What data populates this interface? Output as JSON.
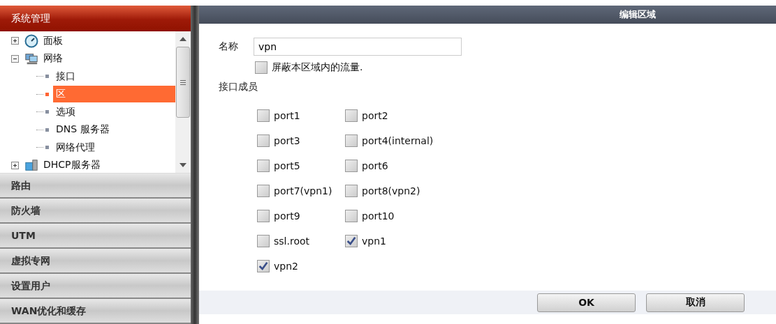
{
  "sidebar": {
    "header": "系统管理",
    "tree": [
      {
        "label": "面板",
        "kind": "gauge",
        "expanded": false
      },
      {
        "label": "网络",
        "kind": "network",
        "expanded": true,
        "children": [
          {
            "label": "接口",
            "selected": false
          },
          {
            "label": "区",
            "selected": true
          },
          {
            "label": "选项",
            "selected": false
          },
          {
            "label": "DNS 服务器",
            "selected": false
          },
          {
            "label": "网络代理",
            "selected": false
          }
        ]
      },
      {
        "label": "DHCP服务器",
        "kind": "server",
        "expanded": false
      }
    ],
    "sections": [
      "路由",
      "防火墙",
      "UTM",
      "虚拟专网",
      "设置用户",
      "WAN优化和缓存"
    ]
  },
  "dialog": {
    "title": "编辑区域",
    "name_label": "名称",
    "name_value": "vpn",
    "block_traffic": {
      "label": "屏蔽本区域内的流量.",
      "checked": false
    },
    "members_label": "接口成员",
    "members": [
      {
        "label": "port1",
        "checked": false
      },
      {
        "label": "port2",
        "checked": false
      },
      {
        "label": "port3",
        "checked": false
      },
      {
        "label": "port4(internal)",
        "checked": false
      },
      {
        "label": "port5",
        "checked": false
      },
      {
        "label": "port6",
        "checked": false
      },
      {
        "label": "port7(vpn1)",
        "checked": false
      },
      {
        "label": "port8(vpn2)",
        "checked": false
      },
      {
        "label": "port9",
        "checked": false
      },
      {
        "label": "port10",
        "checked": false
      },
      {
        "label": "ssl.root",
        "checked": false
      },
      {
        "label": "vpn1",
        "checked": true
      },
      {
        "label": "vpn2",
        "checked": true
      }
    ],
    "buttons": [
      "OK",
      "取消"
    ]
  }
}
